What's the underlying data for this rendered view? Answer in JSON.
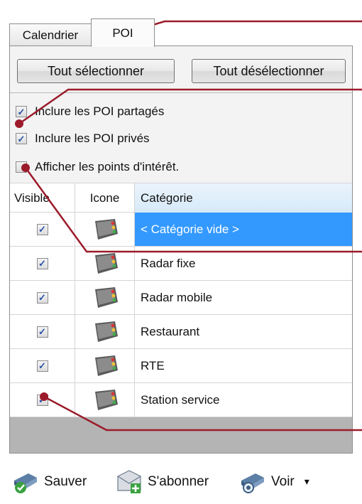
{
  "tabs": [
    {
      "label": "Calendrier"
    },
    {
      "label": "POI"
    }
  ],
  "buttons": {
    "select_all": "Tout sélectionner",
    "deselect_all": "Tout désélectionner"
  },
  "options": [
    {
      "label": "Inclure les POI partagés",
      "checked": true
    },
    {
      "label": "Inclure les POI privés",
      "checked": true
    },
    {
      "label": "Afficher les points d'intérêt.",
      "checked": false
    }
  ],
  "grid": {
    "columns": [
      "Visible",
      "Icone",
      "Catégorie"
    ],
    "rows": [
      {
        "visible": true,
        "icon": "poi-category-icon",
        "category": "< Catégorie vide >",
        "selected": true
      },
      {
        "visible": true,
        "icon": "poi-category-icon",
        "category": "Radar fixe",
        "selected": false
      },
      {
        "visible": true,
        "icon": "poi-category-icon",
        "category": "Radar mobile",
        "selected": false
      },
      {
        "visible": true,
        "icon": "poi-category-icon",
        "category": "Restaurant",
        "selected": false
      },
      {
        "visible": true,
        "icon": "poi-category-icon",
        "category": "RTE",
        "selected": false
      },
      {
        "visible": true,
        "icon": "poi-category-icon",
        "category": "Station service",
        "selected": false
      }
    ]
  },
  "toolbar": {
    "save": "Sauver",
    "subscribe": "S'abonner",
    "view": "Voir",
    "view_dropdown": "▾"
  },
  "colors": {
    "selection": "#3399ff",
    "callout": "#9b1b2a",
    "checkmark": "#2753a6"
  }
}
